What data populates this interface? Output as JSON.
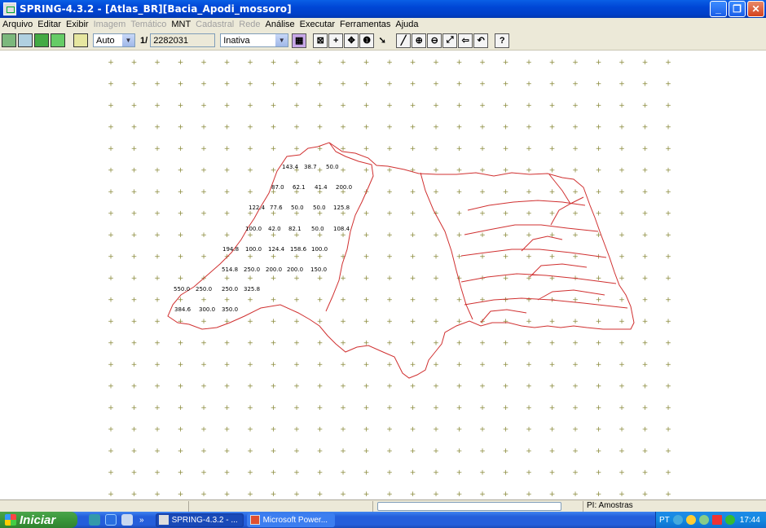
{
  "window": {
    "title": "SPRING-4.3.2 - [Atlas_BR][Bacia_Apodi_mossoro]",
    "controls": [
      "minimize",
      "restore",
      "close"
    ]
  },
  "menu": [
    {
      "label": "Arquivo",
      "enabled": true
    },
    {
      "label": "Editar",
      "enabled": true
    },
    {
      "label": "Exibir",
      "enabled": true
    },
    {
      "label": "Imagem",
      "enabled": false
    },
    {
      "label": "Temático",
      "enabled": false
    },
    {
      "label": "MNT",
      "enabled": true
    },
    {
      "label": "Cadastral",
      "enabled": false
    },
    {
      "label": "Rede",
      "enabled": false
    },
    {
      "label": "Análise",
      "enabled": true
    },
    {
      "label": "Executar",
      "enabled": true
    },
    {
      "label": "Ferramentas",
      "enabled": true
    },
    {
      "label": "Ajuda",
      "enabled": true
    }
  ],
  "toolbar": {
    "scale_mode": "Auto",
    "scale_prefix": "1/",
    "scale_value": "2282031",
    "edit_mode": "Inativa"
  },
  "samples": [
    "143.4",
    "38.7",
    "50.0",
    "87.0",
    "62.1",
    "41.4",
    "200.0",
    "122.4",
    "77.6",
    "50.0",
    "50.0",
    "125.8",
    "100.0",
    "42.0",
    "82.1",
    "50.0",
    "108.4",
    "194.8",
    "100.0",
    "124.4",
    "158.6",
    "100.0",
    "514.8",
    "250.0",
    "200.0",
    "200.0",
    "150.0",
    "550.0",
    "250.0",
    "250.0",
    "325.8",
    "384.6",
    "300.0",
    "350.0"
  ],
  "colors": {
    "grid_cross": "#8a8a3a",
    "boundary": "#d03030",
    "label": "#000000"
  },
  "status": {
    "info": "PI: Amostras"
  },
  "taskbar": {
    "start_label": "Iniciar",
    "tasks": [
      "SPRING-4.3.2 - ...",
      "Microsoft Power..."
    ],
    "language": "PT",
    "clock": "17:44"
  }
}
